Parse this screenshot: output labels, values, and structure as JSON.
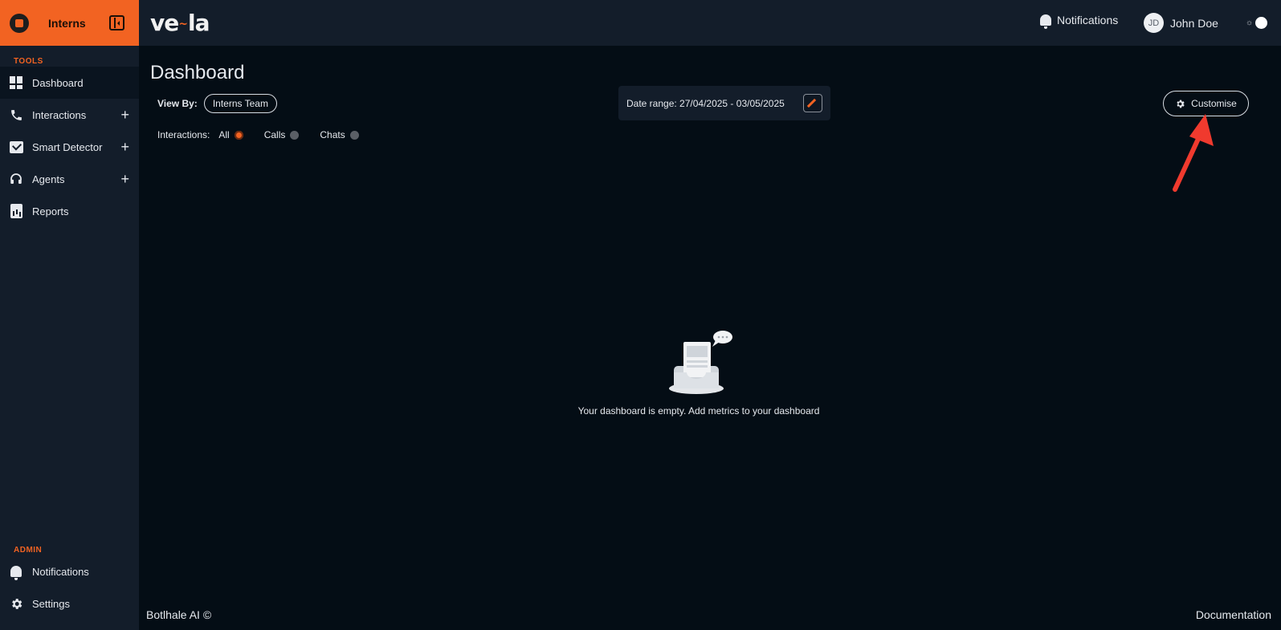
{
  "brand": {
    "name": "Interns",
    "logo_icon": "building-icon",
    "collapse_icon": "sidebar-collapse-icon"
  },
  "topbar": {
    "logo_text": "ve",
    "logo_text_2": "la",
    "notifications_label": "Notifications",
    "user_initials": "JD",
    "user_name": "John Doe"
  },
  "sidebar": {
    "tools_label": "TOOLS",
    "tools": [
      {
        "label": "Dashboard",
        "icon": "dashboard-icon",
        "active": true
      },
      {
        "label": "Interactions",
        "icon": "phone-icon",
        "expandable": true
      },
      {
        "label": "Smart Detector",
        "icon": "smart-detector-icon",
        "expandable": true
      },
      {
        "label": "Agents",
        "icon": "headset-icon",
        "expandable": true
      },
      {
        "label": "Reports",
        "icon": "report-icon"
      }
    ],
    "admin_label": "ADMIN",
    "admin": [
      {
        "label": "Notifications",
        "icon": "bell-icon"
      },
      {
        "label": "Settings",
        "icon": "gear-icon"
      }
    ]
  },
  "main": {
    "title": "Dashboard",
    "view_by_label": "View By:",
    "view_by_value": "Interns Team",
    "interactions_label": "Interactions:",
    "interaction_options": [
      {
        "label": "All",
        "selected": true
      },
      {
        "label": "Calls",
        "selected": false
      },
      {
        "label": "Chats",
        "selected": false
      }
    ],
    "date_range": "Date range: 27/04/2025 - 03/05/2025",
    "customise_label": "Customise",
    "empty_message": "Your dashboard is empty. Add metrics to your dashboard"
  },
  "footer": {
    "copyright": "Botlhale AI ©",
    "docs_link": "Documentation"
  },
  "colors": {
    "accent": "#f26322",
    "background": "#040d15",
    "panel": "#131d2a",
    "annotation_arrow": "#f03a2e"
  }
}
